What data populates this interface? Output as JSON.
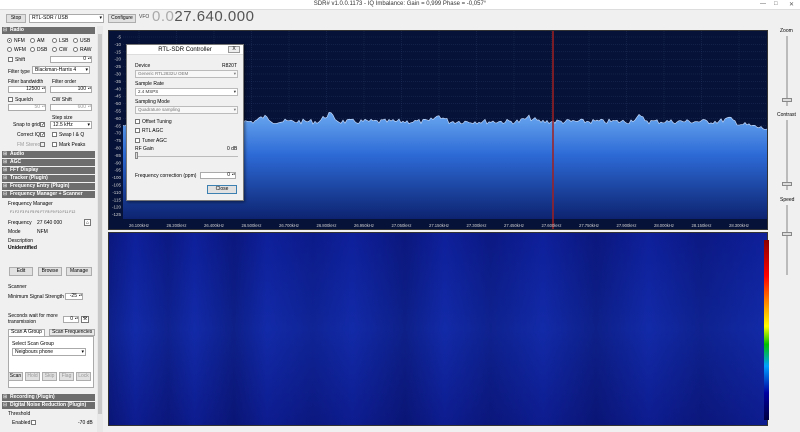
{
  "window": {
    "title": "SDR# v1.0.0.1173 - IQ Imbalance: Gain = 0,999 Phase = -0,057°",
    "min": "—",
    "max": "□",
    "close": "✕"
  },
  "toolbar": {
    "stop_label": "Stop",
    "source": "RTL-SDR / USB",
    "configure_label": "Configure",
    "vfo_label": "VFO",
    "vfo_dim": "0.0",
    "vfo_bright": "27.640.000"
  },
  "radio": {
    "header": "Radio",
    "modes": [
      {
        "label": "NFM",
        "on": true
      },
      {
        "label": "AM"
      },
      {
        "label": "LSB"
      },
      {
        "label": "USB"
      },
      {
        "label": "WFM"
      },
      {
        "label": "DSB"
      },
      {
        "label": "CW"
      },
      {
        "label": "RAW"
      }
    ],
    "shift_label": "Shift",
    "shift_value": "0",
    "filter_type_label": "Filter type",
    "filter_type": "Blackman-Harris 4",
    "filter_bw_label": "Filter bandwidth",
    "filter_bw": "12500",
    "filter_order_label": "Filter order",
    "filter_order": "100",
    "squelch_label": "Squelch",
    "cw_shift_label": "CW Shift",
    "squelch_value": "50",
    "cw_shift_value": "600",
    "step_size_label": "Step size",
    "snap_label": "Snap to grid",
    "step_size": "12.5 kHz",
    "correct_iq_label": "Correct IQ",
    "swap_iq_label": "Swap I & Q",
    "fm_stereo_label": "FM Stereo",
    "mark_peaks_label": "Mark Peaks"
  },
  "sections": {
    "audio": "Audio",
    "agc": "AGC",
    "fft": "FFT Display",
    "tracker": "Tracker (Plugin)",
    "freq_entry": "Frequency Entry (Plugin)",
    "freq_manager": "Frequency Manager + Scanner (Plugin)",
    "recording": "Recording (Plugin)",
    "dnr": "Digital Noise Reduction (Plugin)"
  },
  "freq_manager": {
    "title": "Frequency Manager",
    "fkeys": "F1  F2  F3  F4  F5  F6  F7  F8  F9  F10  F11  F12",
    "frequency_label": "Frequency",
    "frequency": "27 640 000",
    "mode_label": "Mode",
    "mode": "NFM",
    "description_label": "Description",
    "description": "Unidentified",
    "edit": "Edit",
    "browse": "Browse",
    "manage": "Manage"
  },
  "scanner": {
    "title": "Scanner",
    "min_signal_label": "Minimum Signal Strength",
    "min_signal": "-25",
    "wait_label_1": "Seconds wait for more",
    "wait_label_2": "transmission",
    "wait_value": "0",
    "tab_a": "Scan A Group",
    "tab_b": "Scan Frequencies",
    "group_label": "Select Scan Group",
    "group": "Neigbours phone",
    "buttons": [
      "Scan",
      "Hold",
      "Skip",
      "Flag",
      "Lock"
    ]
  },
  "dnr": {
    "threshold_label": "Threshold",
    "enabled_label": "Enabled",
    "value": "-70 dB"
  },
  "spectrum": {
    "db_labels": [
      "-5",
      "-10",
      "-15",
      "-20",
      "-25",
      "-30",
      "-35",
      "-40",
      "-45",
      "-50",
      "-55",
      "-60",
      "-65",
      "-70",
      "-75",
      "-80",
      "-85",
      "-90",
      "-95",
      "-100",
      "-105",
      "-110",
      "-115",
      "-120",
      "-125"
    ],
    "freq_labels": [
      "26.100kHz",
      "26.200kHz",
      "26.400kHz",
      "26.500kHz",
      "26.700kHz",
      "26.800kHz",
      "26.950kHz",
      "27.050kHz",
      "27.150kHz",
      "27.300kHz",
      "27.450kHz",
      "27.600kHz",
      "27.750kHz",
      "27.900kHz",
      "28.000kHz",
      "28.150kHz",
      "28.300kHz"
    ]
  },
  "right": {
    "zoom": "Zoom",
    "contrast": "Contrast",
    "speed": "Speed"
  },
  "dialog": {
    "title": "RTL-SDR Controller",
    "close_x": "X",
    "device_label": "Device",
    "tuner": "R820T",
    "device": "Generic RTL2832U OEM",
    "sample_rate_label": "Sample Rate",
    "sample_rate": "2.4 MSPS",
    "sampling_mode_label": "Sampling Mode",
    "sampling_mode": "Quadrature sampling",
    "offset_tuning": "Offset Tuning",
    "rtl_agc": "RTL AGC",
    "tuner_agc": "Tuner AGC",
    "rf_gain_label": "RF Gain",
    "rf_gain": "0 dB",
    "ppm_label": "Frequency correction (ppm)",
    "ppm": "0",
    "close_btn": "Close"
  }
}
